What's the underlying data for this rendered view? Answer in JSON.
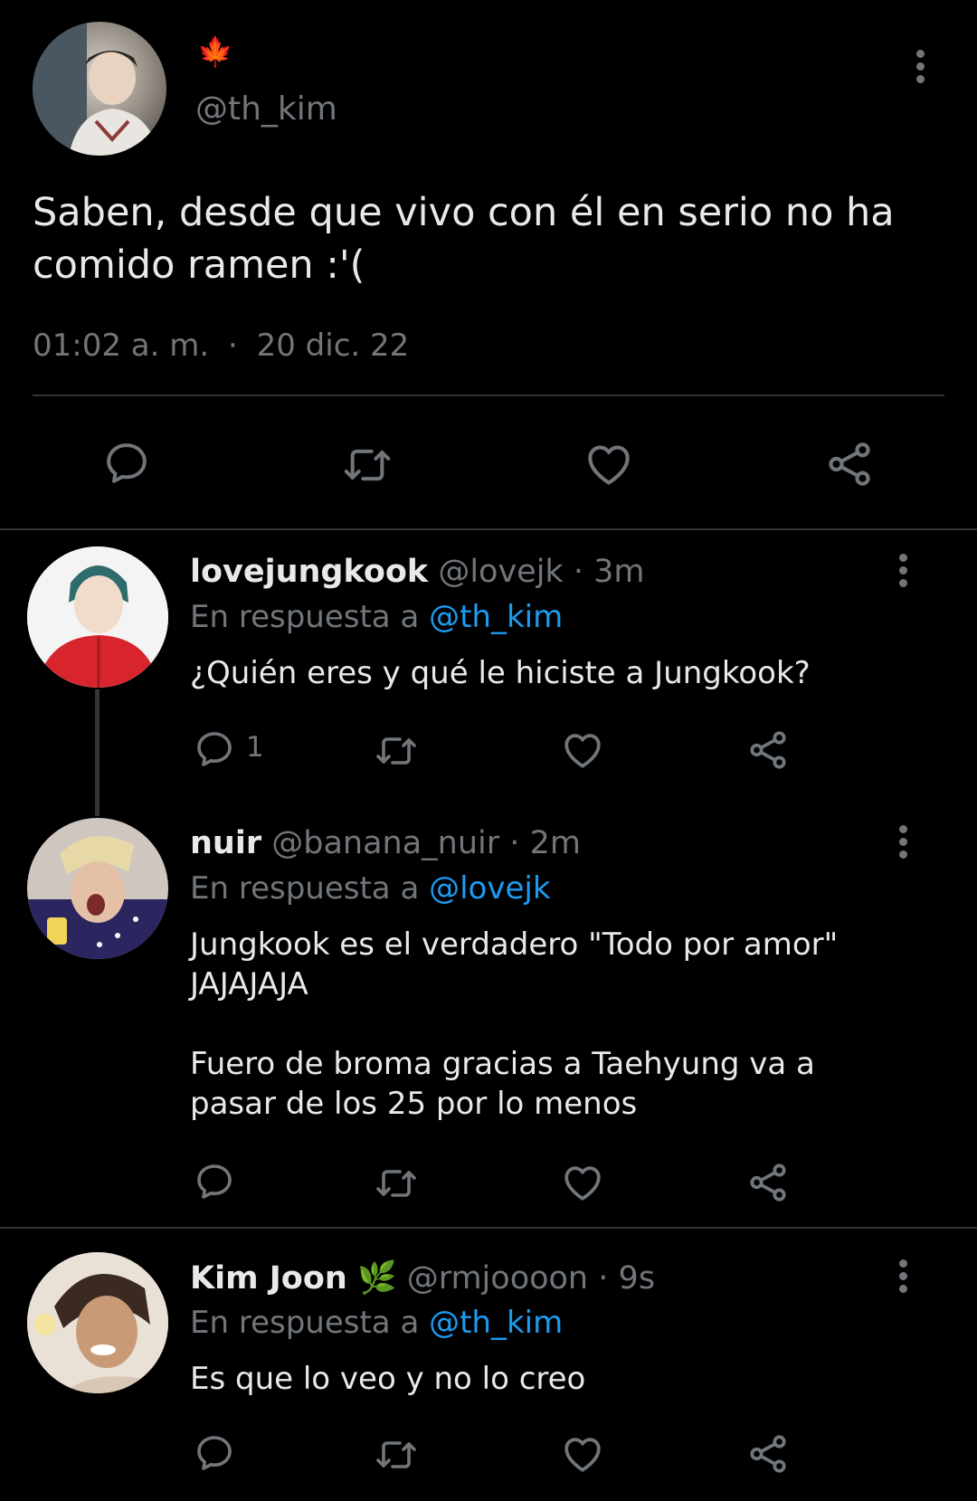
{
  "main_tweet": {
    "display_name_emoji": "🍁",
    "handle": "@th_kim",
    "text": "Saben, desde que vivo con él en serio no ha comido ramen :'(",
    "time": "01:02 a. m.",
    "separator": "·",
    "date": "20 dic. 22"
  },
  "replies": [
    {
      "name": "lovejungkook",
      "handle": "@lovejk",
      "separator": "·",
      "age": "3m",
      "reply_prefix": "En respuesta a",
      "reply_to": "@th_kim",
      "text": "¿Quién eres y qué le hiciste a Jungkook?",
      "reply_count": "1"
    },
    {
      "name": "nuir",
      "handle": "@banana_nuir",
      "separator": "·",
      "age": "2m",
      "reply_prefix": "En respuesta a",
      "reply_to": "@lovejk",
      "text": "Jungkook es el verdadero \"Todo por amor\"\nJAJAJAJA\n\nFuero de broma gracias a Taehyung va a\npasar de los 25 por lo menos"
    },
    {
      "name": "Kim Joon",
      "name_emoji": "🌿",
      "handle": "@rmjoooon",
      "separator": "·",
      "age": "9s",
      "reply_prefix": "En respuesta a",
      "reply_to": "@th_kim",
      "text": "Es que lo veo y no lo creo"
    }
  ],
  "icons": [
    "comment-icon",
    "retweet-icon",
    "like-icon",
    "share-icon",
    "more-icon"
  ],
  "colors": {
    "background": "#000000",
    "text": "#e7e9ea",
    "secondary": "#71767b",
    "link": "#1d9bf0",
    "divider": "#2f3336"
  }
}
